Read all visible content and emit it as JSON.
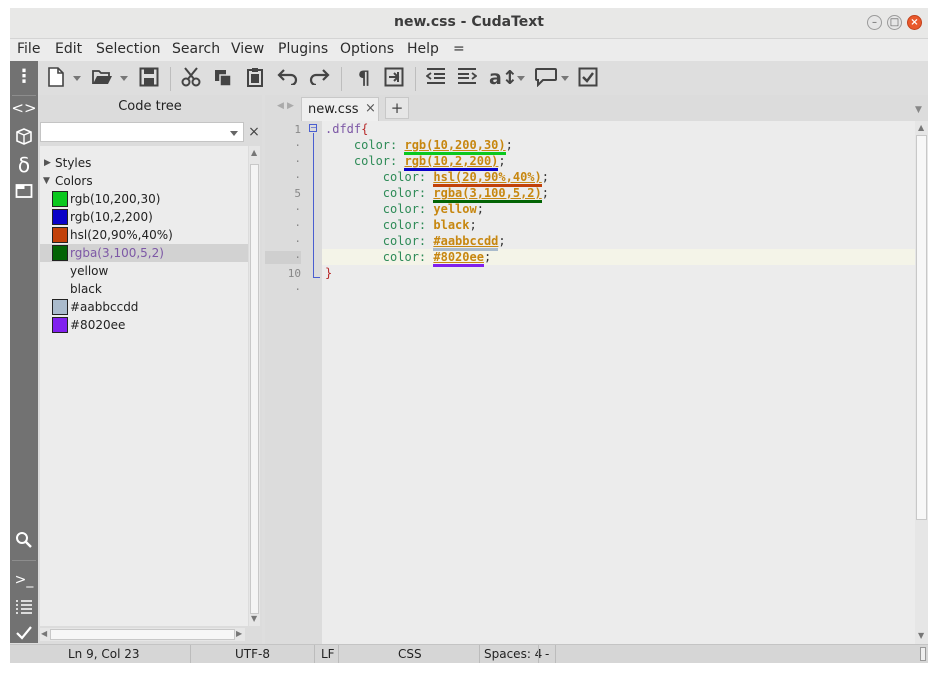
{
  "window": {
    "title": "new.css - CudaText",
    "minimize_glyph": "–",
    "maximize_glyph": "□",
    "close_glyph": "×"
  },
  "menu": {
    "items": [
      {
        "label": "File"
      },
      {
        "label": "Edit"
      },
      {
        "label": "Selection"
      },
      {
        "label": "Search"
      },
      {
        "label": "View"
      },
      {
        "label": "Plugins"
      },
      {
        "label": "Options"
      },
      {
        "label": "Help"
      },
      {
        "label": "="
      }
    ]
  },
  "toolbar": {
    "icons": [
      "menu-dots-icon",
      "new-file-icon",
      "open-file-icon",
      "save-icon",
      "cut-icon",
      "copy-icon",
      "paste-icon",
      "undo-icon",
      "redo-icon",
      "pilcrow-icon",
      "wrap-icon",
      "unindent-icon",
      "indent-icon",
      "text-case-icon",
      "comment-icon",
      "checkbox-icon"
    ]
  },
  "sidebar": {
    "icons": [
      "code-tree-icon",
      "project-icon",
      "delta-icon",
      "tabs-icon",
      "search-icon",
      "console-icon",
      "output-icon",
      "validate-icon"
    ]
  },
  "code_tree": {
    "header": "Code tree",
    "filter_placeholder": "",
    "close_glyph": "×",
    "groups": [
      {
        "label": "Styles",
        "expanded": false
      },
      {
        "label": "Colors",
        "expanded": true
      }
    ],
    "items": [
      {
        "label": "rgb(10,200,30)",
        "swatch": "#0ac81e",
        "selected": false
      },
      {
        "label": "rgb(10,2,200)",
        "swatch": "#0a02c8",
        "selected": false
      },
      {
        "label": "hsl(20,90%,40%)",
        "swatch": "#c2410a",
        "selected": false
      },
      {
        "label": "rgba(3,100,5,2)",
        "swatch": "#036405",
        "selected": true
      },
      {
        "label": "yellow",
        "swatch": "",
        "selected": false
      },
      {
        "label": "black",
        "swatch": "",
        "selected": false
      },
      {
        "label": "#aabbccdd",
        "swatch": "#aabbcc",
        "selected": false
      },
      {
        "label": "#8020ee",
        "swatch": "#8020ee",
        "selected": false
      }
    ]
  },
  "tabs": [
    {
      "label": "new.css",
      "close_glyph": "×",
      "active": true
    }
  ],
  "new_tab_label": "+",
  "editor": {
    "line_numbers": [
      "1",
      "·",
      "·",
      "·",
      "5",
      "·",
      "·",
      "·",
      "·",
      "10",
      "·"
    ],
    "lines": [
      {
        "indent": "",
        "selector": ".dfdf",
        "open": "{"
      },
      {
        "indent": "    ",
        "prop": "color: ",
        "value": "rgb(10,200,30)",
        "end": ";",
        "underline": "#0ac81e"
      },
      {
        "indent": "    ",
        "prop": "color: ",
        "value": "rgb(10,2,200)",
        "end": ";",
        "underline": "#0a02c8"
      },
      {
        "indent": "        ",
        "prop": "color: ",
        "value": "hsl(20,90%,40%)",
        "end": ";",
        "underline": "#c2410a"
      },
      {
        "indent": "        ",
        "prop": "color: ",
        "value": "rgba(3,100,5,2)",
        "end": ";",
        "underline": "#036405"
      },
      {
        "indent": "        ",
        "prop": "color: ",
        "value": "yellow",
        "end": ";",
        "underline": ""
      },
      {
        "indent": "        ",
        "prop": "color: ",
        "value": "black",
        "end": ";",
        "underline": ""
      },
      {
        "indent": "        ",
        "prop": "color: ",
        "value": "#aabbccdd",
        "end": ";",
        "underline": "#aabbcc"
      },
      {
        "indent": "        ",
        "prop": "color: ",
        "value": "#8020ee",
        "end": ";",
        "underline": "#8020ee"
      },
      {
        "indent": "",
        "close": "}"
      }
    ]
  },
  "status": {
    "position": "Ln 9, Col 23",
    "encoding": "UTF-8",
    "line_ending": "LF",
    "lexer": "CSS",
    "indent": "Spaces: 4",
    "extra": "-"
  }
}
